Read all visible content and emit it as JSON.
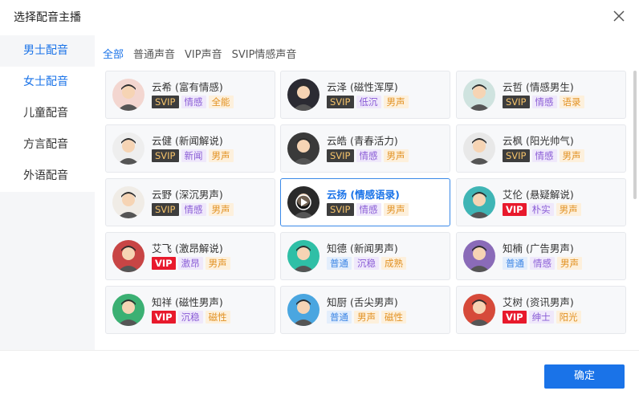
{
  "dialog": {
    "title": "选择配音主播",
    "confirm_label": "确定"
  },
  "sidebar": {
    "items": [
      {
        "label": "男士配音"
      },
      {
        "label": "女士配音"
      },
      {
        "label": "儿童配音"
      },
      {
        "label": "方言配音"
      },
      {
        "label": "外语配音"
      }
    ]
  },
  "tabs": [
    {
      "label": "全部"
    },
    {
      "label": "普通声音"
    },
    {
      "label": "VIP声音"
    },
    {
      "label": "SVIP情感声音"
    }
  ],
  "voices": [
    {
      "name": "云希 (富有情感)",
      "tags": [
        "SVIP",
        "情感",
        "全能"
      ]
    },
    {
      "name": "云泽 (磁性浑厚)",
      "tags": [
        "SVIP",
        "低沉",
        "男声"
      ]
    },
    {
      "name": "云哲 (情感男生)",
      "tags": [
        "SVIP",
        "情感",
        "语录"
      ]
    },
    {
      "name": "云健 (新闻解说)",
      "tags": [
        "SVIP",
        "新闻",
        "男声"
      ]
    },
    {
      "name": "云皓 (青春活力)",
      "tags": [
        "SVIP",
        "情感",
        "男声"
      ]
    },
    {
      "name": "云枫 (阳光帅气)",
      "tags": [
        "SVIP",
        "情感",
        "男声"
      ]
    },
    {
      "name": "云野 (深沉男声)",
      "tags": [
        "SVIP",
        "情感",
        "男声"
      ]
    },
    {
      "name": "云扬 (情感语录)",
      "tags": [
        "SVIP",
        "情感",
        "男声"
      ]
    },
    {
      "name": "艾伦 (悬疑解说)",
      "tags": [
        "VIP",
        "朴实",
        "男声"
      ]
    },
    {
      "name": "艾飞 (激昂解说)",
      "tags": [
        "VIP",
        "激昂",
        "男声"
      ]
    },
    {
      "name": "知德 (新闻男声)",
      "tags": [
        "普通",
        "沉稳",
        "成熟"
      ]
    },
    {
      "name": "知楠 (广告男声)",
      "tags": [
        "普通",
        "情感",
        "男声"
      ]
    },
    {
      "name": "知祥 (磁性男声)",
      "tags": [
        "VIP",
        "沉稳",
        "磁性"
      ]
    },
    {
      "name": "知厨 (舌尖男声)",
      "tags": [
        "普通",
        "男声",
        "磁性"
      ]
    },
    {
      "name": "艾树 (资讯男声)",
      "tags": [
        "VIP",
        "绅士",
        "阳光"
      ]
    }
  ],
  "colors": {
    "accent": "#1a73e8",
    "svip_bg": "#3d3d3d",
    "svip_text": "#f5c36a",
    "vip_bg": "#e8192c"
  }
}
